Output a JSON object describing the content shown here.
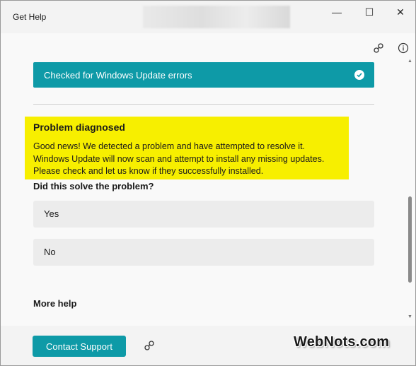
{
  "window": {
    "title": "Get Help",
    "controls": {
      "minimize": "—",
      "maximize": "☐",
      "close": "✕"
    }
  },
  "header_icons": [
    "share-icon",
    "info-icon"
  ],
  "status_bar": {
    "label": "Checked for Windows Update errors",
    "state": "checked"
  },
  "diagnosis": {
    "title": "Problem diagnosed",
    "lines": [
      "Good news!  We detected a problem and have attempted to resolve it.",
      "Windows Update will now scan and attempt to install any missing updates.",
      "Please check and let us know if they successfully installed."
    ]
  },
  "feedback": {
    "question": "Did this solve the problem?",
    "options": [
      "Yes",
      "No"
    ]
  },
  "more_help": {
    "label": "More help"
  },
  "footer": {
    "contact_button": "Contact Support",
    "watermark": "WebNots.com"
  },
  "colors": {
    "accent": "#0e9aa7",
    "highlight": "#f7ef00",
    "option_bg": "#ececec",
    "content_bg": "#f9f9f9"
  }
}
